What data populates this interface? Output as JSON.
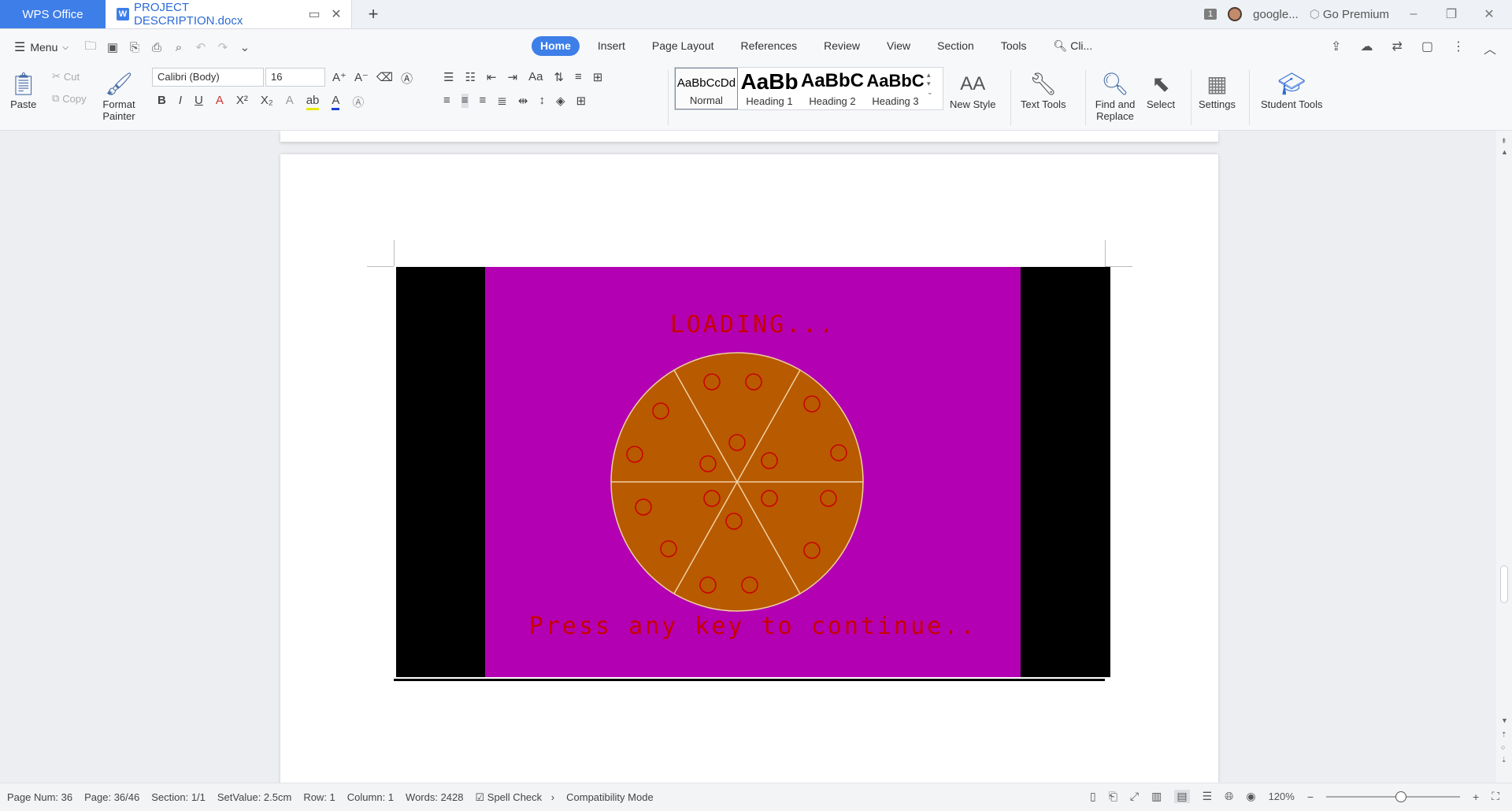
{
  "titlebar": {
    "app_tab": "WPS Office",
    "doc_tab": "PROJECT DESCRIPTION.docx",
    "notif_count": "1",
    "account": "google...",
    "premium": "Go Premium"
  },
  "quickbar": {
    "menu_label": "Menu",
    "tabs": [
      "Home",
      "Insert",
      "Page Layout",
      "References",
      "Review",
      "View",
      "Section",
      "Tools"
    ],
    "active_tab": "Home",
    "search_label": "Cli..."
  },
  "ribbon": {
    "paste": "Paste",
    "cut": "Cut",
    "copy": "Copy",
    "format_painter": "Format Painter",
    "font_name": "Calibri (Body)",
    "font_size": "16",
    "styles": [
      {
        "preview": "AaBbCcDd",
        "label": "Normal"
      },
      {
        "preview": "AaBb",
        "label": "Heading 1"
      },
      {
        "preview": "AaBbC",
        "label": "Heading 2"
      },
      {
        "preview": "AaBbC",
        "label": "Heading 3"
      }
    ],
    "new_style": "New Style",
    "text_tools": "Text Tools",
    "find_replace": "Find and Replace",
    "select": "Select",
    "settings": "Settings",
    "student_tools": "Student Tools"
  },
  "document": {
    "game_loading": "LOADING...",
    "game_prompt": "Press any key to continue..",
    "colors": {
      "background": "#b200b2",
      "pizza": "#b85a00",
      "text": "#c80000"
    }
  },
  "status": {
    "page_num": "Page Num: 36",
    "page": "Page: 36/46",
    "section": "Section: 1/1",
    "setvalue": "SetValue: 2.5cm",
    "row": "Row: 1",
    "column": "Column: 1",
    "words": "Words: 2428",
    "spell_check": "Spell Check",
    "compat": "Compatibility Mode",
    "zoom": "120%"
  }
}
